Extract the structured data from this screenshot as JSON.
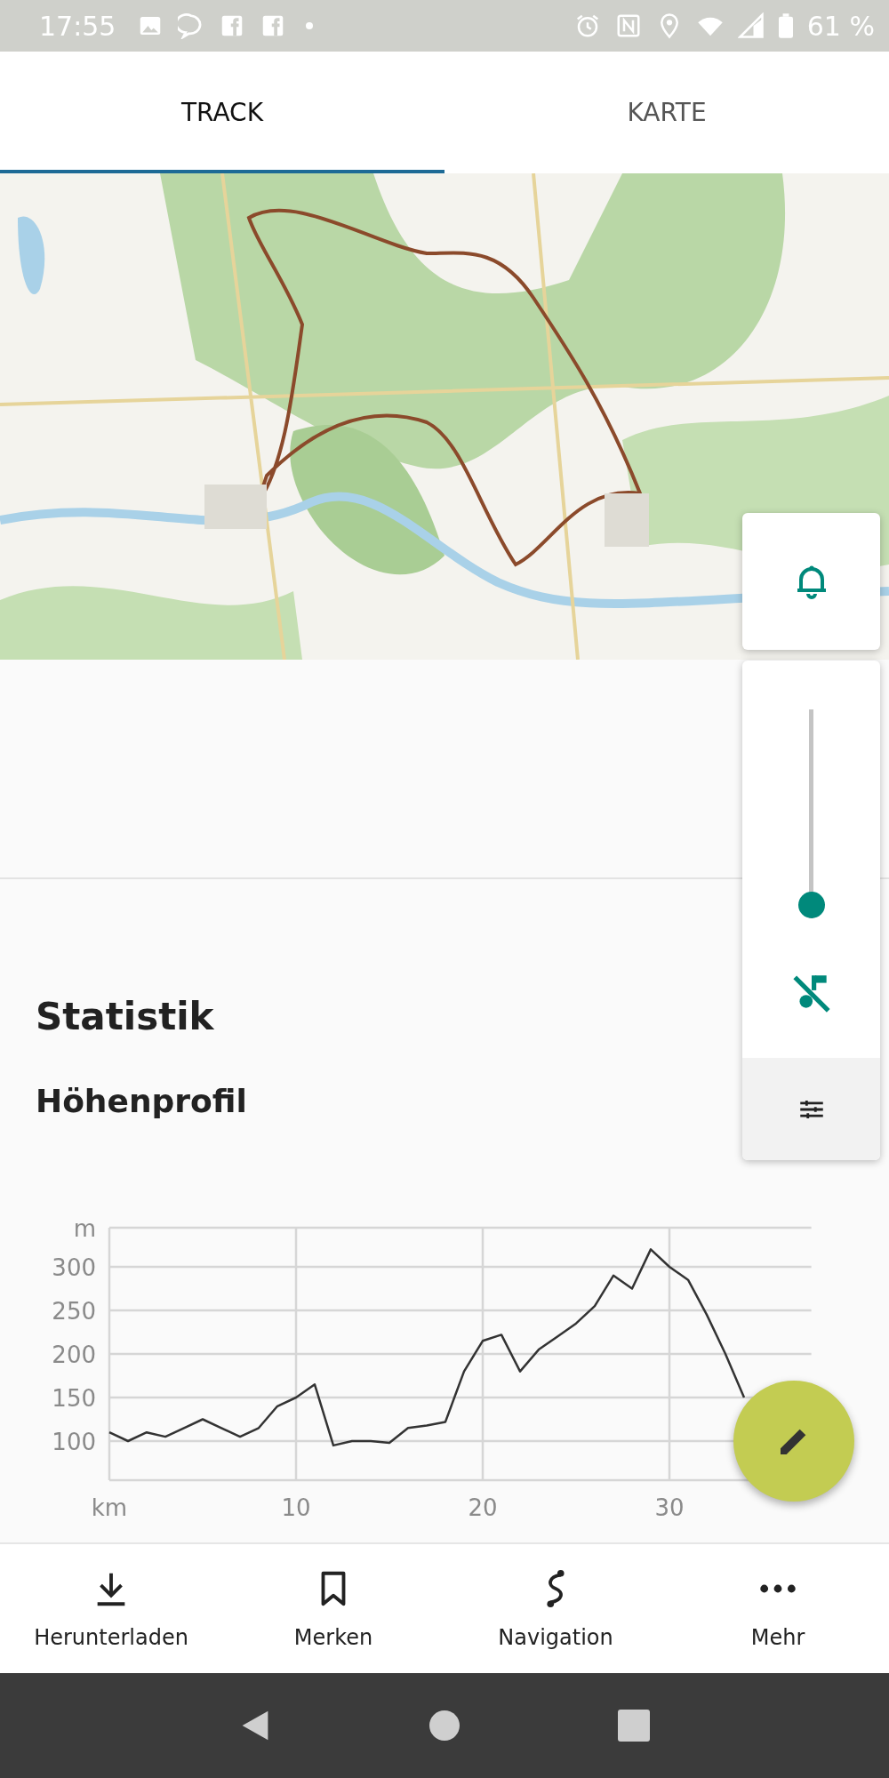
{
  "status_bar": {
    "time": "17:55",
    "battery": "61 %"
  },
  "tabs": [
    {
      "label": "TRACK",
      "selected": true
    },
    {
      "label": "KARTE",
      "selected": false
    }
  ],
  "volume_panel": {
    "level": 0
  },
  "statistics_title": "Statistik",
  "elevation_title": "Höhenprofil",
  "chart_data": {
    "type": "line",
    "xlabel": "km",
    "ylabel": "m",
    "xlim": [
      0,
      37.6
    ],
    "ylim": [
      55,
      345
    ],
    "xticks": [
      10,
      20,
      30
    ],
    "yticks": [
      100,
      150,
      200,
      250,
      300
    ],
    "grid": true,
    "x": [
      0,
      1,
      2,
      3,
      4,
      5,
      6,
      7,
      8,
      9,
      10,
      11,
      12,
      13,
      14,
      15,
      16,
      17,
      18,
      19,
      20,
      21,
      22,
      23,
      24,
      25,
      26,
      27,
      28,
      29,
      30,
      31,
      32,
      33,
      34
    ],
    "series": [
      {
        "color": "#333333",
        "values": [
          110,
          100,
          110,
          105,
          115,
          125,
          115,
          105,
          115,
          140,
          150,
          165,
          95,
          100,
          100,
          98,
          115,
          118,
          122,
          180,
          215,
          222,
          180,
          205,
          220,
          235,
          255,
          290,
          275,
          320,
          300,
          285,
          245,
          200,
          150
        ]
      }
    ]
  },
  "bottom_nav": [
    {
      "label": "Herunterladen"
    },
    {
      "label": "Merken"
    },
    {
      "label": "Navigation"
    },
    {
      "label": "Mehr"
    }
  ]
}
